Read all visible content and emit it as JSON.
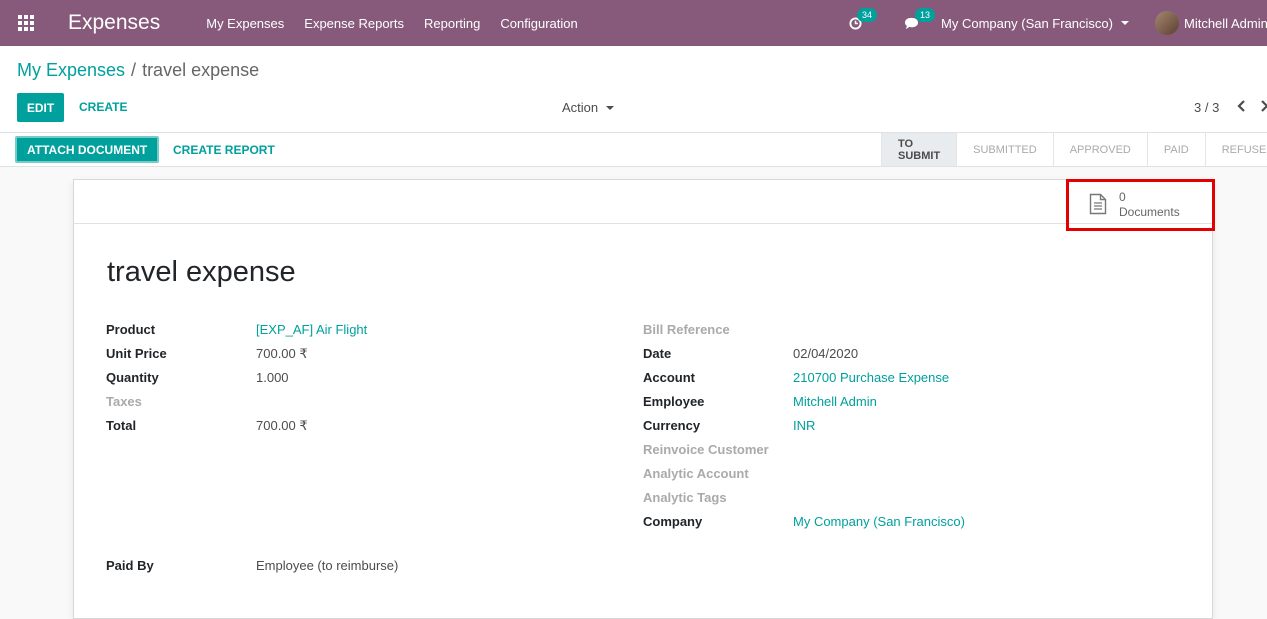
{
  "navbar": {
    "brand": "Expenses",
    "menu": [
      "My Expenses",
      "Expense Reports",
      "Reporting",
      "Configuration"
    ],
    "activity_count": "34",
    "message_count": "13",
    "company": "My Company (San Francisco)",
    "user": "Mitchell Admin"
  },
  "breadcrumb": {
    "parent": "My Expenses",
    "separator": "/",
    "current": "travel expense"
  },
  "buttons": {
    "edit": "EDIT",
    "create": "CREATE",
    "action": "Action"
  },
  "pager": {
    "value": "3 / 3",
    "prev": "‹",
    "next": "›"
  },
  "statusbar": {
    "attach": "ATTACH DOCUMENT",
    "create_report": "CREATE REPORT",
    "stages": [
      "TO SUBMIT",
      "SUBMITTED",
      "APPROVED",
      "PAID",
      "REFUSED"
    ],
    "active_stage": "TO SUBMIT"
  },
  "documents": {
    "count": "0",
    "label": "Documents"
  },
  "record": {
    "title": "travel expense",
    "left": [
      {
        "label": "Product",
        "value": "[EXP_AF] Air Flight"
      },
      {
        "label": "Unit Price",
        "value": "700.00 ₹"
      },
      {
        "label": "Quantity",
        "value": "1.000"
      },
      {
        "label": "Taxes",
        "value": ""
      },
      {
        "label": "Total",
        "value": "700.00 ₹"
      }
    ],
    "right": [
      {
        "label": "Bill Reference",
        "value": ""
      },
      {
        "label": "Date",
        "value": "02/04/2020"
      },
      {
        "label": "Account",
        "value": "210700 Purchase Expense"
      },
      {
        "label": "Employee",
        "value": "Mitchell Admin"
      },
      {
        "label": "Currency",
        "value": "INR"
      },
      {
        "label": "Reinvoice Customer",
        "value": ""
      },
      {
        "label": "Analytic Account",
        "value": ""
      },
      {
        "label": "Analytic Tags",
        "value": ""
      },
      {
        "label": "Company",
        "value": "My Company (San Francisco)"
      }
    ],
    "paid_by": {
      "label": "Paid By",
      "value": "Employee (to reimburse)"
    }
  },
  "colors": {
    "navbar": "#875a7b",
    "accent": "#00a09d",
    "highlight": "#e30000"
  }
}
